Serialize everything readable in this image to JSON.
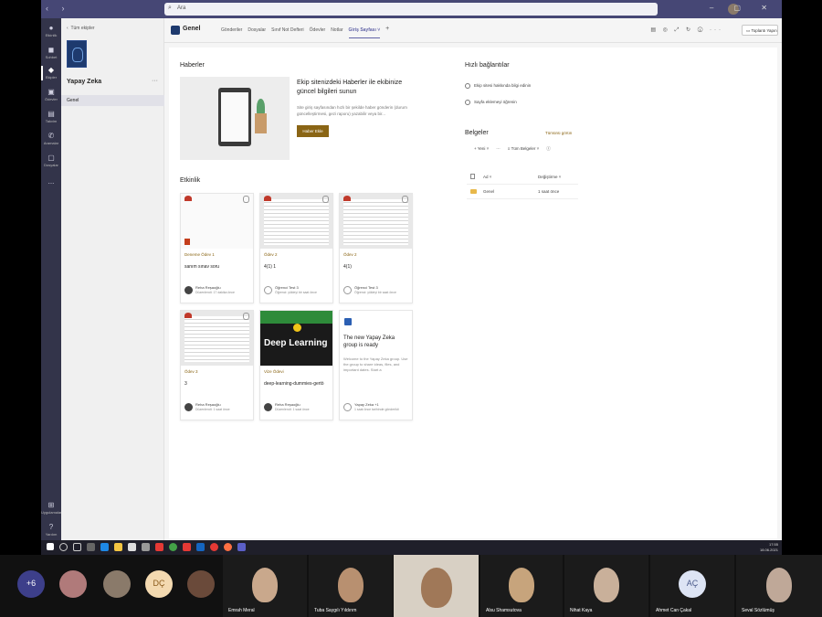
{
  "titlebar": {
    "search_text": "Ara"
  },
  "rail": [
    {
      "label": "Etkinlik",
      "icon": "bell-icon"
    },
    {
      "label": "Sohbet",
      "icon": "chat-icon"
    },
    {
      "label": "Ekipler",
      "icon": "teams-icon",
      "active": true
    },
    {
      "label": "Ödevler",
      "icon": "assignments-icon"
    },
    {
      "label": "Takvim",
      "icon": "calendar-icon"
    },
    {
      "label": "Aramalar",
      "icon": "phone-icon"
    },
    {
      "label": "Dosyalar",
      "icon": "files-icon"
    },
    {
      "label": "...",
      "icon": "more-icon"
    }
  ],
  "rail_bottom": [
    {
      "label": "Uygulamalar",
      "icon": "apps-icon"
    },
    {
      "label": "Yardım",
      "icon": "help-icon"
    }
  ],
  "team": {
    "back_label": "Tüm ekipler",
    "name": "Yapay Zeka",
    "more": "···",
    "channel": "Genel"
  },
  "header": {
    "channel": "Genel",
    "tabs": [
      "Gönderiler",
      "Dosyalar",
      "Sınıf Not Defteri",
      "Ödevler",
      "Notlar",
      "Giriş Sayfası"
    ],
    "active_tab": "Giriş Sayfası ˅",
    "add_tab": "+",
    "meet_label": "Toplantı Yapın"
  },
  "news": {
    "heading": "Haberler",
    "title": "Ekip sitenizdeki Haberler ile ekibinize güncel bilgileri sunun",
    "desc": "Site giriş sayfasından hızlı bir şekilde haber gönderin (durum güncelleştirmesi, gezi raporu) yazabilir veya bir...",
    "button": "Haber Ekle"
  },
  "activity": {
    "heading": "Etkinlik",
    "cards": [
      {
        "type": "Deneme Ödev 1",
        "name": "sanım sınav soru",
        "who": "Reha Reşaoğlu",
        "when": "Düzenlendi: 17 dakika önce",
        "avatar": "photo"
      },
      {
        "type": "Ödev 2",
        "name": "4(1) 1",
        "who": "Öğrenci Test 3",
        "when": "Öğrenci: yükleyi bir saat önce",
        "avatar": "gray"
      },
      {
        "type": "Ödev 2",
        "name": "4(1)",
        "who": "Öğrenci Test 3",
        "when": "Öğrenci: yükleyi bir saat önce",
        "avatar": "gray"
      },
      {
        "type": "Ödev 3",
        "name": "3",
        "who": "Reha Reşaoğlu",
        "when": "Düzenlendi: 1 saat önce",
        "avatar": "photo"
      },
      {
        "type": "Vize Ödevi",
        "name": "deep-learning-dummies-gertö",
        "who": "Reha Reşaoğlu",
        "when": "Düzenlendi: 1 saat önce",
        "avatar": "photo",
        "cover": "Deep Learning"
      },
      {
        "title": "The new Yapay Zeka group is ready",
        "desc": "Welcome to the Yapay Zeka group. Use the group to share ideas, files, and important dates. Start a",
        "who": "Yapay Zeka +1",
        "when": "1 saat önce tarihinde gönderildi",
        "avatar": "gray"
      }
    ]
  },
  "quick_links": {
    "heading": "Hızlı bağlantılar",
    "items": [
      "Ekip sitesi hakkında bilgi edinin",
      "Sayfa eklemeyi öğrenin"
    ]
  },
  "documents": {
    "heading": "Belgeler",
    "see_all": "Tümünü görün",
    "new_label": "+ Yeni ˅",
    "more": "···",
    "view_label": "Tüm Belgeler ˅",
    "col_name": "Ad ˅",
    "col_modified": "Değiştirme ˅",
    "rows": [
      {
        "name": "Genel",
        "modified": "1 saat önce"
      }
    ]
  },
  "taskbar": {
    "time": "17:55",
    "date": "18.06.2021"
  },
  "gallery": {
    "overflow": "+6",
    "people": [
      {
        "name": "",
        "initials": ""
      },
      {
        "name": "",
        "initials": ""
      },
      {
        "name": "",
        "initials": "DÇ"
      },
      {
        "name": "",
        "initials": ""
      },
      {
        "name": "Emrah Meral",
        "initials": ""
      },
      {
        "name": "Tuba Saygılı Yıldırım",
        "initials": ""
      },
      {
        "name": "",
        "initials": ""
      },
      {
        "name": "Alsu Shamsutova",
        "initials": ""
      },
      {
        "name": "Nihat Kaya",
        "initials": ""
      },
      {
        "name": "Ahmet Can Çakal",
        "initials": "AÇ"
      },
      {
        "name": "Seval Sözlümüş",
        "initials": ""
      }
    ]
  }
}
